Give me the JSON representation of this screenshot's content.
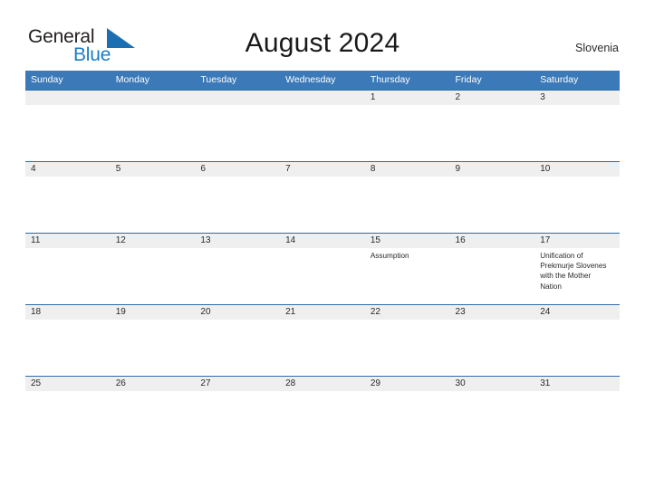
{
  "brand": {
    "name_part1": "General",
    "name_part2": "Blue",
    "flag_icon": "blue-flag-triangle",
    "color_dark": "#231f20",
    "color_blue": "#1b7cc4"
  },
  "header": {
    "title": "August 2024",
    "country": "Slovenia"
  },
  "calendar": {
    "accent_header_bg": "#3b79b8",
    "row_divider_color": "#2c6ca8",
    "day_band_bg": "#efefef",
    "day_names": [
      "Sunday",
      "Monday",
      "Tuesday",
      "Wednesday",
      "Thursday",
      "Friday",
      "Saturday"
    ],
    "weeks": [
      [
        {
          "date": "",
          "events": []
        },
        {
          "date": "",
          "events": []
        },
        {
          "date": "",
          "events": []
        },
        {
          "date": "",
          "events": []
        },
        {
          "date": "1",
          "events": []
        },
        {
          "date": "2",
          "events": []
        },
        {
          "date": "3",
          "events": []
        }
      ],
      [
        {
          "date": "4",
          "events": []
        },
        {
          "date": "5",
          "events": []
        },
        {
          "date": "6",
          "events": []
        },
        {
          "date": "7",
          "events": []
        },
        {
          "date": "8",
          "events": []
        },
        {
          "date": "9",
          "events": []
        },
        {
          "date": "10",
          "events": []
        }
      ],
      [
        {
          "date": "11",
          "events": []
        },
        {
          "date": "12",
          "events": []
        },
        {
          "date": "13",
          "events": []
        },
        {
          "date": "14",
          "events": []
        },
        {
          "date": "15",
          "events": [
            "Assumption"
          ]
        },
        {
          "date": "16",
          "events": []
        },
        {
          "date": "17",
          "events": [
            "Unification of Prekmurje Slovenes with the Mother Nation"
          ]
        }
      ],
      [
        {
          "date": "18",
          "events": []
        },
        {
          "date": "19",
          "events": []
        },
        {
          "date": "20",
          "events": []
        },
        {
          "date": "21",
          "events": []
        },
        {
          "date": "22",
          "events": []
        },
        {
          "date": "23",
          "events": []
        },
        {
          "date": "24",
          "events": []
        }
      ],
      [
        {
          "date": "25",
          "events": []
        },
        {
          "date": "26",
          "events": []
        },
        {
          "date": "27",
          "events": []
        },
        {
          "date": "28",
          "events": []
        },
        {
          "date": "29",
          "events": []
        },
        {
          "date": "30",
          "events": []
        },
        {
          "date": "31",
          "events": []
        }
      ]
    ]
  }
}
